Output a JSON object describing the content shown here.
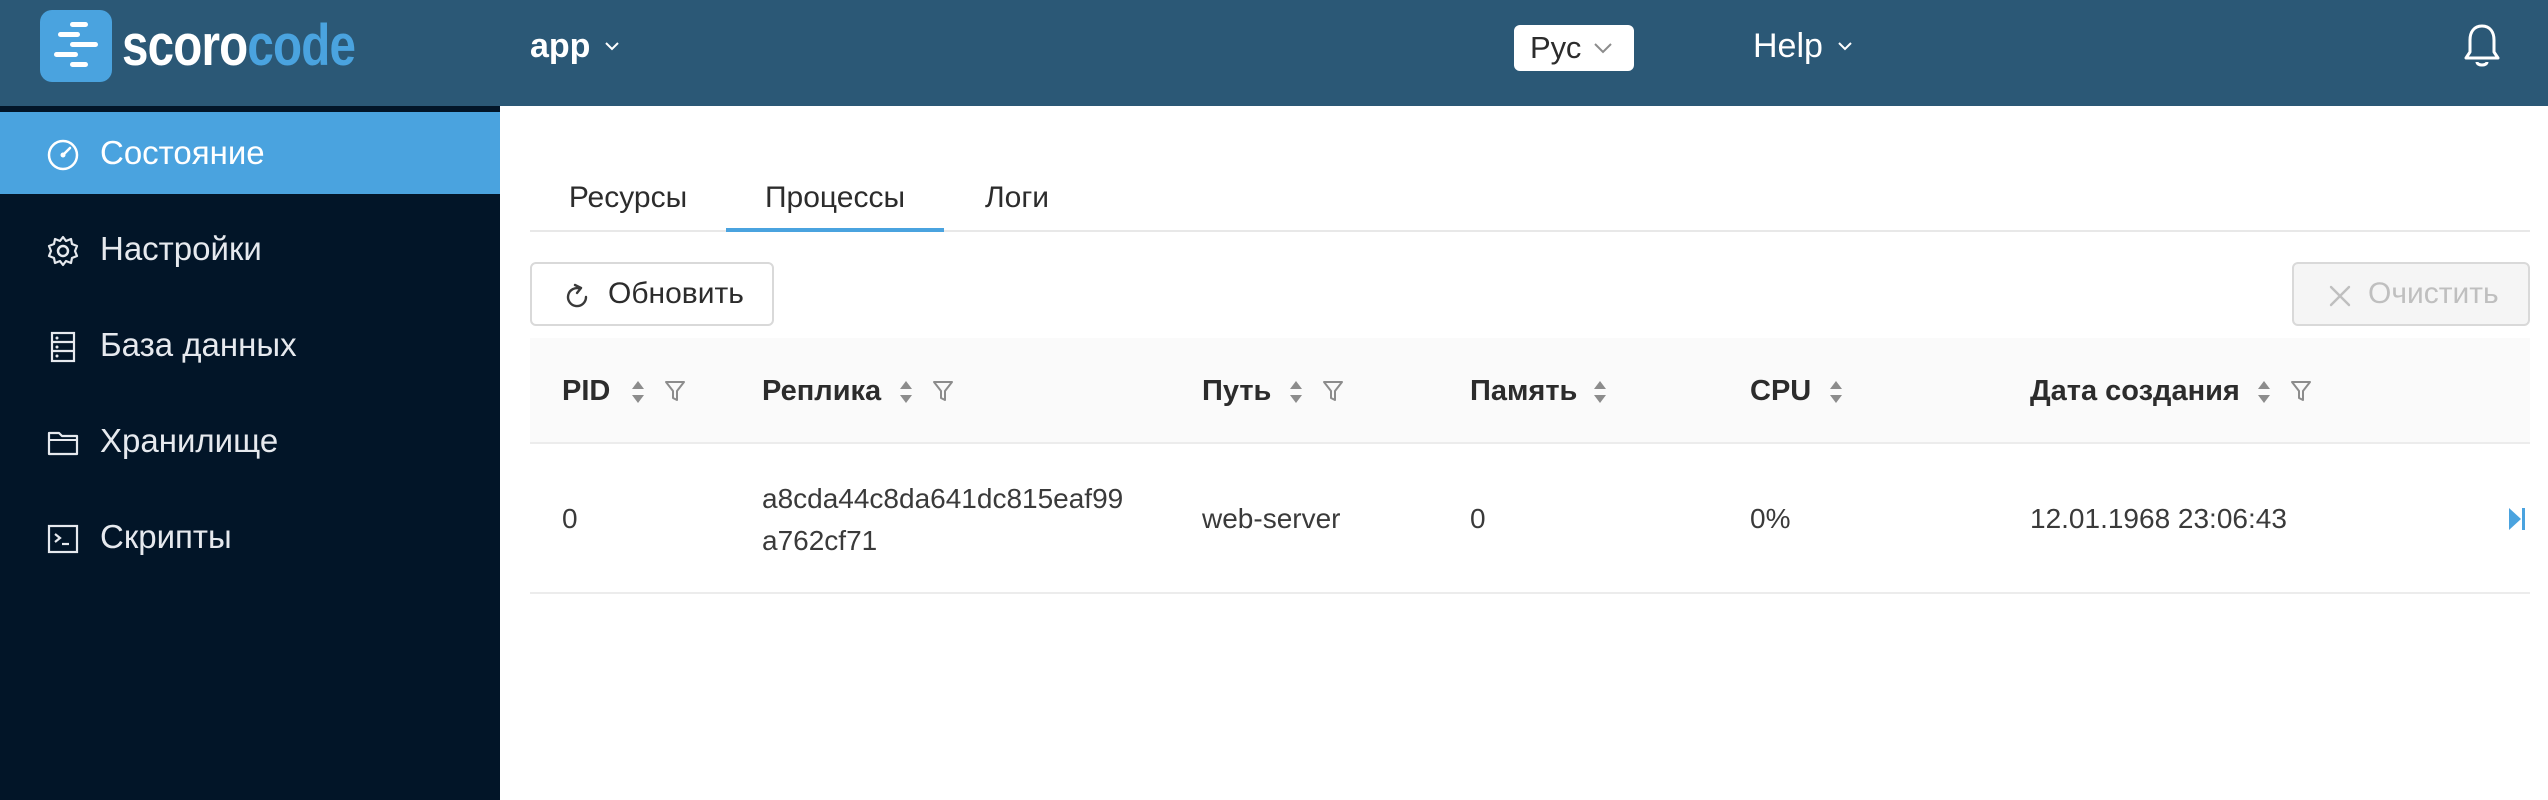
{
  "header": {
    "logo_text_a": "scoro",
    "logo_text_b": "code",
    "app_label": "app",
    "language_label": "Рус",
    "help_label": "Help",
    "bell_icon": "bell-icon"
  },
  "sidebar": {
    "items": [
      {
        "label": "Состояние",
        "icon": "dashboard-gauge-icon",
        "active": true
      },
      {
        "label": "Настройки",
        "icon": "gear-icon",
        "active": false
      },
      {
        "label": "База данных",
        "icon": "database-icon",
        "active": false
      },
      {
        "label": "Хранилище",
        "icon": "folder-icon",
        "active": false
      },
      {
        "label": "Скрипты",
        "icon": "terminal-icon",
        "active": false
      }
    ]
  },
  "tabs": [
    {
      "label": "Ресурсы",
      "active": false
    },
    {
      "label": "Процессы",
      "active": true
    },
    {
      "label": "Логи",
      "active": false
    }
  ],
  "toolbar": {
    "refresh_label": "Обновить",
    "clear_label": "Очистить"
  },
  "table": {
    "columns": [
      {
        "label": "PID",
        "sortable": true,
        "filterable": true
      },
      {
        "label": "Реплика",
        "sortable": true,
        "filterable": true
      },
      {
        "label": "Путь",
        "sortable": true,
        "filterable": true
      },
      {
        "label": "Память",
        "sortable": true,
        "filterable": false
      },
      {
        "label": "CPU",
        "sortable": true,
        "filterable": false
      },
      {
        "label": "Дата создания",
        "sortable": true,
        "filterable": true
      }
    ],
    "rows": [
      {
        "pid": "0",
        "replica_line1": "a8cda44c8da641dc815eaf99",
        "replica_line2": "a762cf71",
        "path": "web-server",
        "memory": "0",
        "cpu": "0%",
        "created": "12.01.1968 23:06:43"
      }
    ]
  },
  "colors": {
    "header_bg": "#2b5876",
    "sidebar_bg": "#021528",
    "accent": "#4aa3df"
  }
}
